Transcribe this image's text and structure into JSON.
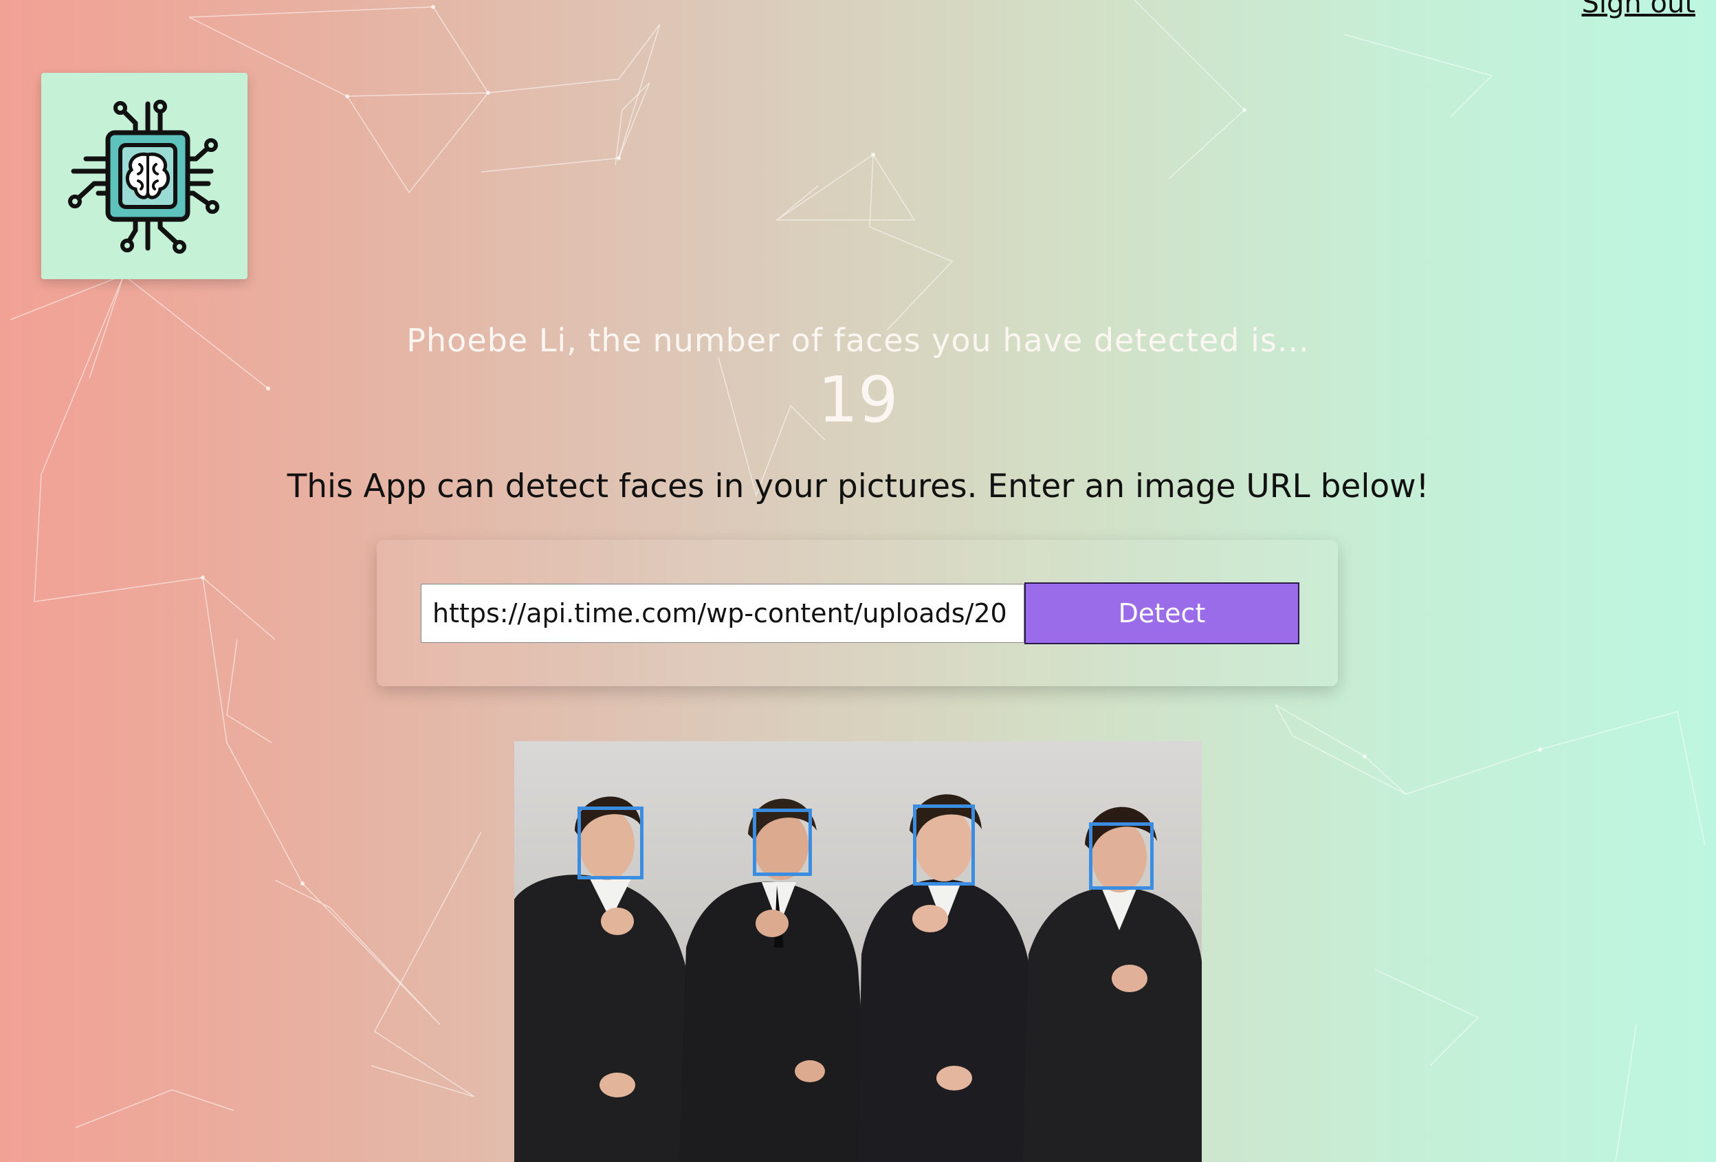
{
  "header": {
    "signout_label": "Sign out"
  },
  "logo": {
    "icon": "brain-chip-icon",
    "background": "#c5f1d7"
  },
  "rank": {
    "message": "Phoebe Li, the number of faces you have detected is...",
    "count": "19"
  },
  "intro": {
    "text": "This App can detect faces in your pictures. Enter an image URL below!"
  },
  "form": {
    "url_value": "https://api.time.com/wp-content/uploads/20",
    "detect_label": "Detect",
    "button_color": "#9b6cea"
  },
  "result": {
    "image": "group-photo-four-men-in-suits",
    "face_box_color": "#3a8de0",
    "faces_shown": 4
  }
}
